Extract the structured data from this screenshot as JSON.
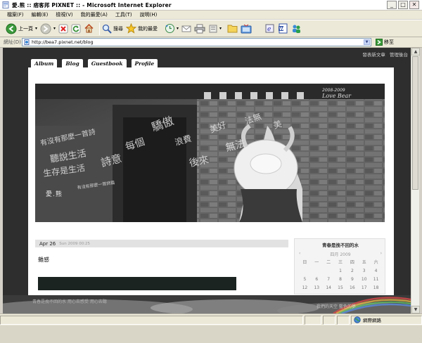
{
  "window": {
    "title": "愛.熊 :: 痞客邦 PIXNET :: - Microsoft Internet Explorer",
    "minimize": "_",
    "maximize": "□",
    "close": "✕"
  },
  "menu": [
    "檔案(F)",
    "編輯(E)",
    "檢視(V)",
    "我的最愛(A)",
    "工具(T)",
    "說明(H)"
  ],
  "toolbar": {
    "back_label": "上一頁",
    "search_label": "搜尋",
    "favorites_label": "我的最愛"
  },
  "address": {
    "label": "網址(D)",
    "url": "http://bea7.pixnet.net/blog",
    "go_label": "移至"
  },
  "blog": {
    "top_links": [
      "發表新文章",
      "管理後台"
    ],
    "nav_tabs": [
      "Album",
      "Blog",
      "Guestbook",
      "Profile"
    ],
    "banner_name": "愛.熊",
    "banner_date": "2008-2009",
    "banner_sign": "Love Bear",
    "post": {
      "date": "Apr 26",
      "datetime": "Sun 2009 00:25",
      "title": "雜感"
    },
    "sidebar": {
      "title": "青春是挽不回的水",
      "cal_prev": "‹",
      "cal_month": "四月 2009",
      "cal_next": "›",
      "weekdays": [
        "日",
        "一",
        "二",
        "三",
        "四",
        "五",
        "六"
      ],
      "days": [
        "",
        "",
        "",
        "1",
        "2",
        "3",
        "4",
        "5",
        "6",
        "7",
        "8",
        "9",
        "10",
        "11",
        "12",
        "13",
        "14",
        "15",
        "16",
        "17",
        "18"
      ]
    },
    "footer_left": "青春是挽不回的水 用心去感受 用心去聽",
    "footer_right": "我們的天空 藍色的夢"
  },
  "status": {
    "text": "",
    "zone_label": "網際網路"
  },
  "colors": {
    "page_bg": "#2e2e2e",
    "xp_chrome": "#ece9d8",
    "post_block": "#1b2420"
  }
}
